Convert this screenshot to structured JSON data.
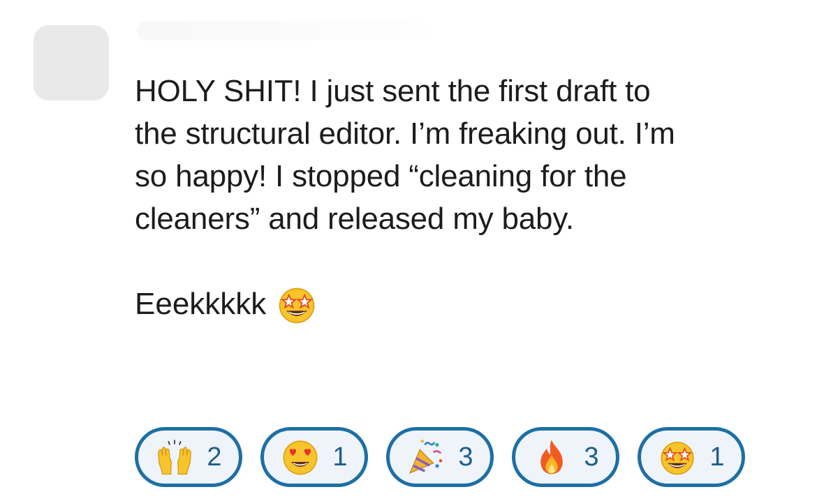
{
  "message": {
    "lines": [
      "HOLY SHIT! I just sent the first draft to",
      "the structural editor. I’m freaking out. I’m",
      "so happy! I stopped “cleaning for the",
      "cleaners” and released my baby."
    ],
    "followup": "Eeekkkkk",
    "followup_emoji": "star-struck-icon"
  },
  "reactions": [
    {
      "icon": "raising-hands-icon",
      "count": "2"
    },
    {
      "icon": "heart-eyes-icon",
      "count": "1"
    },
    {
      "icon": "party-popper-icon",
      "count": "3"
    },
    {
      "icon": "fire-icon",
      "count": "3"
    },
    {
      "icon": "star-struck-icon",
      "count": "1"
    }
  ],
  "colors": {
    "reaction_border": "#1d6fa5",
    "reaction_bg": "#eef4fa",
    "text": "#1d1c1d"
  }
}
